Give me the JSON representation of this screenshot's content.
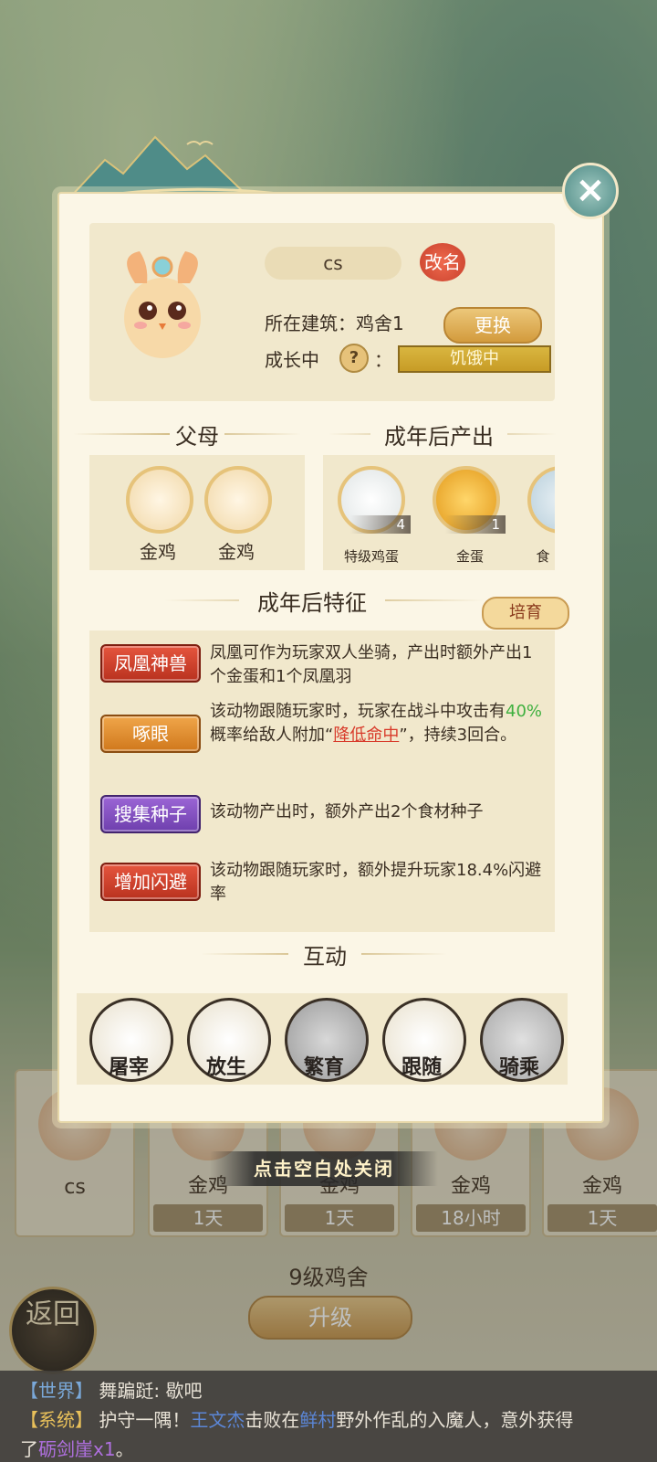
{
  "modal": {
    "pet_name": "cs",
    "rename_label": "改名",
    "location_label": "所在建筑：鸡舍1",
    "change_label": "更换",
    "growth_label": "成长中",
    "help_mark": "?",
    "colon": "：",
    "status": "饥饿中",
    "parents_title": "父母",
    "output_title": "成年后产出",
    "parents": [
      {
        "name": "金鸡"
      },
      {
        "name": "金鸡"
      }
    ],
    "outputs": [
      {
        "name": "特级鸡蛋",
        "count": "4"
      },
      {
        "name": "金蛋",
        "count": "1"
      },
      {
        "name": "食"
      }
    ],
    "traits_title": "成年后特征",
    "breed_label": "培育",
    "traits": [
      {
        "tag": "凤凰神兽",
        "desc": "凤凰可作为玩家双人坐骑，产出时额外产出1个金蛋和1个凤凰羽"
      },
      {
        "tag": "啄眼",
        "desc_a": "该动物跟随玩家时，玩家在战斗中攻击有",
        "desc_pct": "40%",
        "desc_b": "概率给敌人附加“",
        "desc_link": "降低命中",
        "desc_c": "”，持续3回合。"
      },
      {
        "tag": "搜集种子",
        "desc": "该动物产出时，额外产出2个食材种子"
      },
      {
        "tag": "增加闪避",
        "desc": "该动物跟随玩家时，额外提升玩家18.4%闪避率"
      }
    ],
    "interact_title": "互动",
    "actions": [
      {
        "label": "屠宰",
        "icon": "cleaver-icon"
      },
      {
        "label": "放生",
        "icon": "bird-icon"
      },
      {
        "label": "繁育",
        "icon": "hearts-icon"
      },
      {
        "label": "跟随",
        "icon": "paw-icon"
      },
      {
        "label": "骑乘",
        "icon": "saddle-icon"
      }
    ],
    "close_icon": "close-icon"
  },
  "tap_close": "点击空白处关闭",
  "background_list": [
    {
      "name": "cs",
      "time": ""
    },
    {
      "name": "金鸡",
      "time": "1天"
    },
    {
      "name": "金鸡",
      "time": "1天"
    },
    {
      "name": "金鸡",
      "time": "18小时"
    },
    {
      "name": "金鸡",
      "time": "1天"
    }
  ],
  "building_title": "9级鸡舍",
  "upgrade_label": "升级",
  "back_label": "返回",
  "chat": {
    "world_channel": "【世界】",
    "world_text": "舞蹁跹: 歇吧",
    "sys_channel": "【系统】",
    "sys_a": "护守一隅！",
    "sys_player": "王文杰",
    "sys_b": "击败在",
    "sys_place": "鲜村",
    "sys_c": "野外作乱的入魔人，意外获得",
    "sys_d": "了",
    "sys_item": "砺剑崖",
    "sys_qty": "x1",
    "sys_end": "。"
  }
}
